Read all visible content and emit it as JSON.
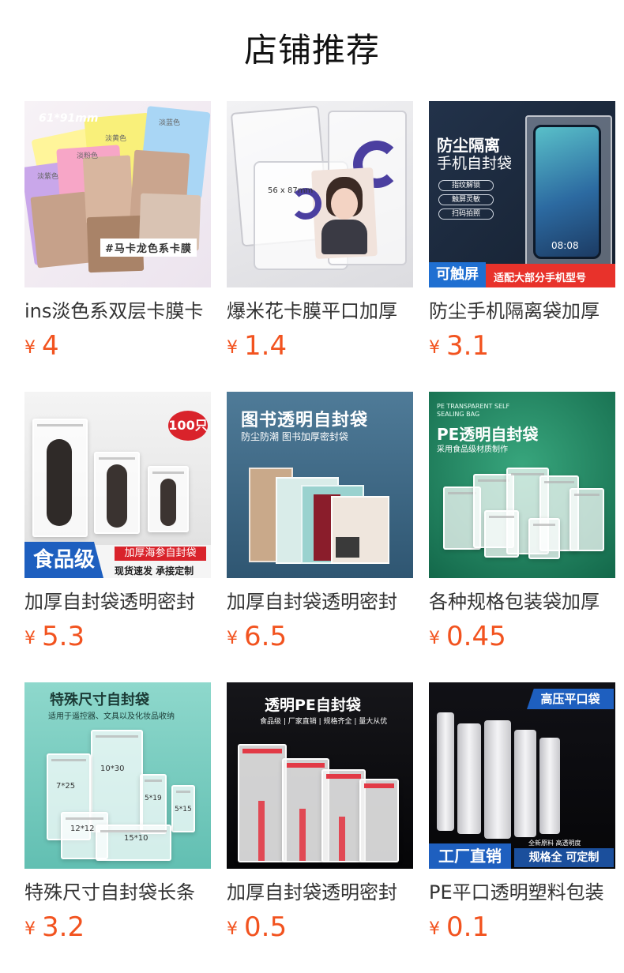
{
  "section_title": "店铺推荐",
  "currency_symbol": "¥",
  "products": [
    {
      "title": "ins淡色系双层卡膜卡",
      "price": "4",
      "image_text": {
        "top": "61*91mm",
        "tags": [
          "淡黄色",
          "淡蓝色",
          "淡粉色",
          "淡紫色"
        ],
        "banner": "#马卡龙色系卡膜"
      }
    },
    {
      "title": "爆米花卡膜平口加厚",
      "price": "1.4",
      "image_text": {
        "size_label": "56 x 87mm"
      }
    },
    {
      "title": "防尘手机隔离袋加厚",
      "price": "3.1",
      "image_text": {
        "heading1": "防尘隔离",
        "heading2": "手机自封袋",
        "pills": [
          "指纹解锁",
          "触屏灵敏",
          "扫码拍照"
        ],
        "badge": "可触屏",
        "footer": "适配大部分手机型号"
      }
    },
    {
      "title": "加厚自封袋透明密封",
      "price": "5.3",
      "image_text": {
        "badge": "100只",
        "banner": "食品级",
        "tag": "加厚海参自封袋",
        "sub": "现货速发 承接定制"
      }
    },
    {
      "title": "加厚自封袋透明密封",
      "price": "6.5",
      "image_text": {
        "heading": "图书透明自封袋",
        "sub": "防尘防潮 图书加厚密封袋"
      }
    },
    {
      "title": "各种规格包装袋加厚",
      "price": "0.45",
      "image_text": {
        "en": "PE TRANSPARENT SELF SEALING BAG",
        "heading": "PE透明自封袋",
        "sub": "采用食品级材质制作"
      }
    },
    {
      "title": "特殊尺寸自封袋长条",
      "price": "3.2",
      "image_text": {
        "heading": "特殊尺寸自封袋",
        "sub": "适用于遥控器、文具以及化妆品收纳",
        "sizes": [
          "10*30",
          "7*25",
          "5*19",
          "5*15",
          "12*12",
          "15*10"
        ]
      }
    },
    {
      "title": "加厚自封袋透明密封",
      "price": "0.5",
      "image_text": {
        "heading": "透明PE自封袋",
        "sub": "食品级 | 厂家直销 | 规格齐全 | 量大从优"
      }
    },
    {
      "title": "PE平口透明塑料包装",
      "price": "0.1",
      "image_text": {
        "badge": "高压平口袋",
        "banner": "工厂直销",
        "tag": "规格全 可定制",
        "tag_top": "全新原料 高透明度"
      }
    }
  ],
  "colors": {
    "price": "#f2531f",
    "title": "#333333",
    "heading": "#111111"
  }
}
